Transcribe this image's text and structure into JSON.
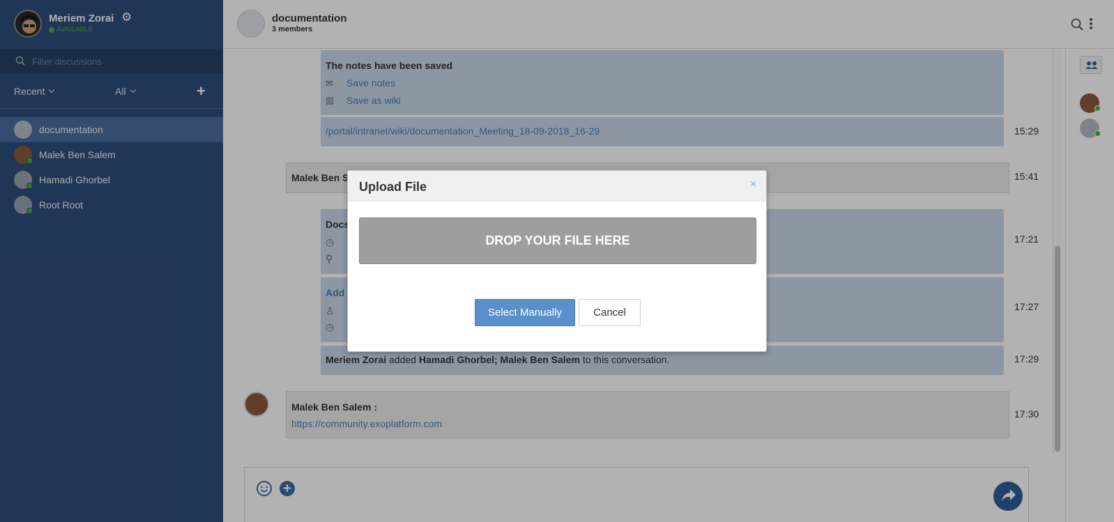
{
  "colors": {
    "sidebar_bg": "#2f4e7c",
    "active_item": "#4a6ea0",
    "online": "#3db53d",
    "accent": "#5b8fcb"
  },
  "user": {
    "name": "Meriem Zorai",
    "status": "AVAILABLE"
  },
  "search": {
    "placeholder": "Filter discussions"
  },
  "filters": {
    "recent": "Recent",
    "all": "All"
  },
  "rooms": [
    {
      "name": "documentation"
    },
    {
      "name": "Malek Ben Salem"
    },
    {
      "name": "Hamadi Ghorbel"
    },
    {
      "name": "Root Root"
    }
  ],
  "header": {
    "title": "documentation",
    "members": "3 members"
  },
  "messages": {
    "notes_title": "The notes have been saved",
    "save_notes": "Save notes",
    "save_wiki": "Save as wiki",
    "wiki_link": "/portal/intranet/wiki/documentation_Meeting_18-09-2018_16-29",
    "time_1": "15:29",
    "malek_short": "Malek Ben S",
    "time_2": "15:41",
    "docs_short": "Docs",
    "time_3": "17:21",
    "add_short": "Add",
    "time_4": "17:27",
    "added_actor": "Meriem Zorai",
    "added_verb": "added",
    "added_targets": "Hamadi Ghorbel; Malek Ben Salem",
    "added_suffix": "to this conversation.",
    "time_5": "17:29",
    "last_author": "Malek Ben Salem :",
    "last_link": "https://community.exoplatform.com",
    "time_6": "17:30"
  },
  "modal": {
    "title": "Upload File",
    "close": "×",
    "drop_text": "DROP YOUR FILE HERE",
    "select_label": "Select Manually",
    "cancel_label": "Cancel"
  }
}
